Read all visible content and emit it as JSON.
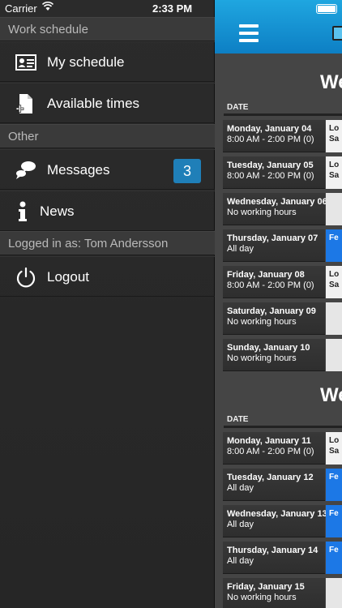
{
  "status_bar": {
    "carrier": "Carrier",
    "time": "2:33 PM"
  },
  "sidebar": {
    "section_work": "Work schedule",
    "my_schedule": "My schedule",
    "available_times": "Available times",
    "section_other": "Other",
    "messages": "Messages",
    "messages_badge": "3",
    "news": "News",
    "logged_in": "Logged in as: Tom Andersson",
    "logout": "Logout"
  },
  "main": {
    "week1_title": "We",
    "week2_title": "We",
    "col_date": "DATE",
    "week1": [
      {
        "date": "Monday, January 04",
        "hours": "8:00 AM - 2:00 PM (0)",
        "side": "Lo\nSa",
        "style": "white"
      },
      {
        "date": "Tuesday, January 05",
        "hours": "8:00 AM - 2:00 PM (0)",
        "side": "Lo\nSa",
        "style": "white"
      },
      {
        "date": "Wednesday, January 06",
        "hours": "No working hours",
        "side": "",
        "style": "light"
      },
      {
        "date": "Thursday, January 07",
        "hours": "All day",
        "side": "Fe",
        "style": "blue"
      },
      {
        "date": "Friday, January 08",
        "hours": "8:00 AM - 2:00 PM (0)",
        "side": "Lo\nSa",
        "style": "white"
      },
      {
        "date": "Saturday, January 09",
        "hours": "No working hours",
        "side": "",
        "style": "light"
      },
      {
        "date": "Sunday, January 10",
        "hours": "No working hours",
        "side": "",
        "style": "light"
      }
    ],
    "week2": [
      {
        "date": "Monday, January 11",
        "hours": "8:00 AM - 2:00 PM (0)",
        "side": "Lo\nSa",
        "style": "white"
      },
      {
        "date": "Tuesday, January 12",
        "hours": "All day",
        "side": "Fe",
        "style": "blue"
      },
      {
        "date": "Wednesday, January 13",
        "hours": "All day",
        "side": "Fe",
        "style": "blue"
      },
      {
        "date": "Thursday, January 14",
        "hours": "All day",
        "side": "Fe",
        "style": "blue"
      },
      {
        "date": "Friday, January 15",
        "hours": "No working hours",
        "side": "",
        "style": "light"
      }
    ]
  }
}
